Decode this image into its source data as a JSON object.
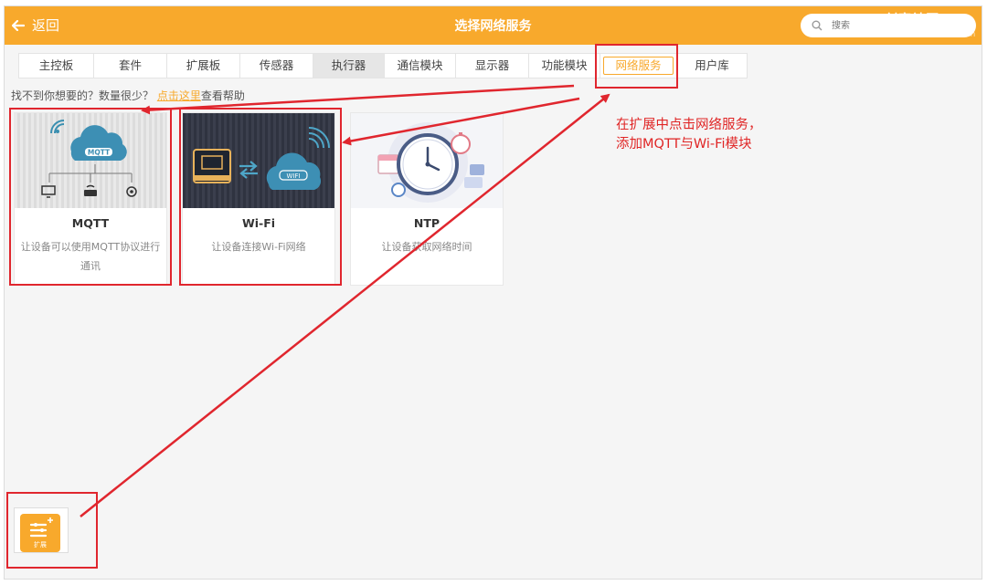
{
  "header": {
    "back_label": "返回",
    "title": "选择网络服务",
    "search_placeholder": "搜索",
    "watermark": "DF创客社区",
    "watermark_sub": "mc.DFRobot.com.cn",
    "bar_color": "#f8a92c"
  },
  "tabs": [
    {
      "label": "主控板"
    },
    {
      "label": "套件"
    },
    {
      "label": "扩展板"
    },
    {
      "label": "传感器"
    },
    {
      "label": "执行器"
    },
    {
      "label": "通信模块"
    },
    {
      "label": "显示器"
    },
    {
      "label": "功能模块"
    },
    {
      "label": "网络服务"
    },
    {
      "label": "用户库"
    }
  ],
  "active_tab": "网络服务",
  "help": {
    "prefix": "找不到你想要的？数量很少？",
    "link": "点击这里",
    "suffix": "查看帮助"
  },
  "cards": [
    {
      "name": "MQTT",
      "desc": "让设备可以使用MQTT协议进行通讯",
      "cloud_text": "MQTT",
      "icon": "mqtt-cloud-icon"
    },
    {
      "name": "Wi-Fi",
      "desc": "让设备连接Wi-Fi网络",
      "cloud_text": "WIFI",
      "icon": "wifi-cloud-icon"
    },
    {
      "name": "NTP",
      "desc": "让设备获取网络时间",
      "icon": "clock-icon"
    }
  ],
  "extension_button": {
    "label": "扩展"
  },
  "annotation": {
    "line1": "在扩展中点击网络服务，",
    "line2": "添加MQTT与Wi-Fi模块",
    "color": "#e0262e"
  }
}
